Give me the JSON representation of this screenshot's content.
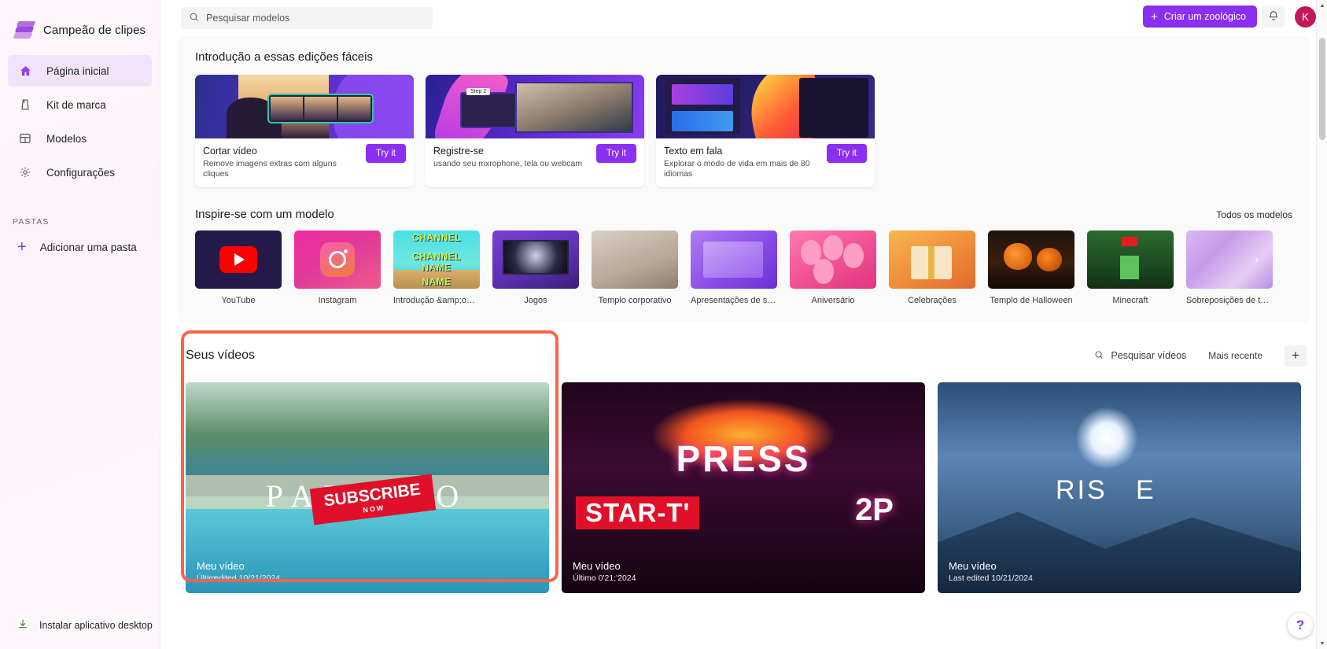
{
  "sidebar": {
    "brand": "Campeão de clipes",
    "items": [
      {
        "label": "Página inicial",
        "icon": "home-icon"
      },
      {
        "label": "Kit de marca",
        "icon": "brand-kit-icon"
      },
      {
        "label": "Modelos",
        "icon": "templates-icon"
      },
      {
        "label": "Configurações",
        "icon": "gear-icon"
      }
    ],
    "folders_caption": "PASTAS",
    "add_folder": "Adicionar uma pasta",
    "install_app": "Instalar aplicativo desktop"
  },
  "topbar": {
    "search_placeholder": "Pesquisar modelos",
    "create_button": "Criar um zoológico",
    "avatar_initial": "K"
  },
  "features": {
    "title": "Introdução a essas edições fáceis",
    "cards": [
      {
        "title": "Cortar vídeo",
        "subtitle": "Remove imagens extras com alguns cliques",
        "cta": "Try it"
      },
      {
        "title": "Registre-se",
        "subtitle": "usando seu mxrophone, tela ou webcam",
        "cta": "Try it"
      },
      {
        "title": "Texto em fala",
        "subtitle": "Explorar o modo de vida em mais de 80 idiomas",
        "cta": "Try it"
      }
    ]
  },
  "templates": {
    "title": "Inspire-se com um modelo",
    "all_link": "Todos os modelos",
    "items": [
      {
        "label": "YouTube"
      },
      {
        "label": "Instagram"
      },
      {
        "label": "Introdução &amp;outro tem..."
      },
      {
        "label": "Jogos"
      },
      {
        "label": "Templo corporativo"
      },
      {
        "label": "Apresentações de slides"
      },
      {
        "label": "Aniversário"
      },
      {
        "label": "Celebrações"
      },
      {
        "label": "Templo de Halloween"
      },
      {
        "label": "Minecraft"
      },
      {
        "label": "Sobreposições de texto"
      }
    ]
  },
  "videos": {
    "title": "Seus vídeos",
    "search_label": "Pesquisar vídeos",
    "sort_label": "Mais recente",
    "add_label": "+",
    "items": [
      {
        "name": "Meu vídeo",
        "edited_prefix": "Últim",
        "edited": "edited 10/21/2024",
        "overlay_word": "PARAÍSO",
        "badge": "SUBSCRIBE",
        "badge_sub": "NOW"
      },
      {
        "name": "Meu vídeo",
        "edited": "Último 0'21;'2024",
        "overlay_word": "PRESS",
        "overlay_word2": "STAR-T'",
        "overlay_word3": "2P"
      },
      {
        "name": "Meu vídeo",
        "edited": "Last edited 10/21/2024",
        "overlay_word": "RIS",
        "overlay_word2": "E"
      }
    ]
  },
  "help": {
    "label": "?"
  },
  "colors": {
    "accent": "#8b2ff0",
    "highlight": "#ff6347",
    "avatar": "#c2185b"
  }
}
